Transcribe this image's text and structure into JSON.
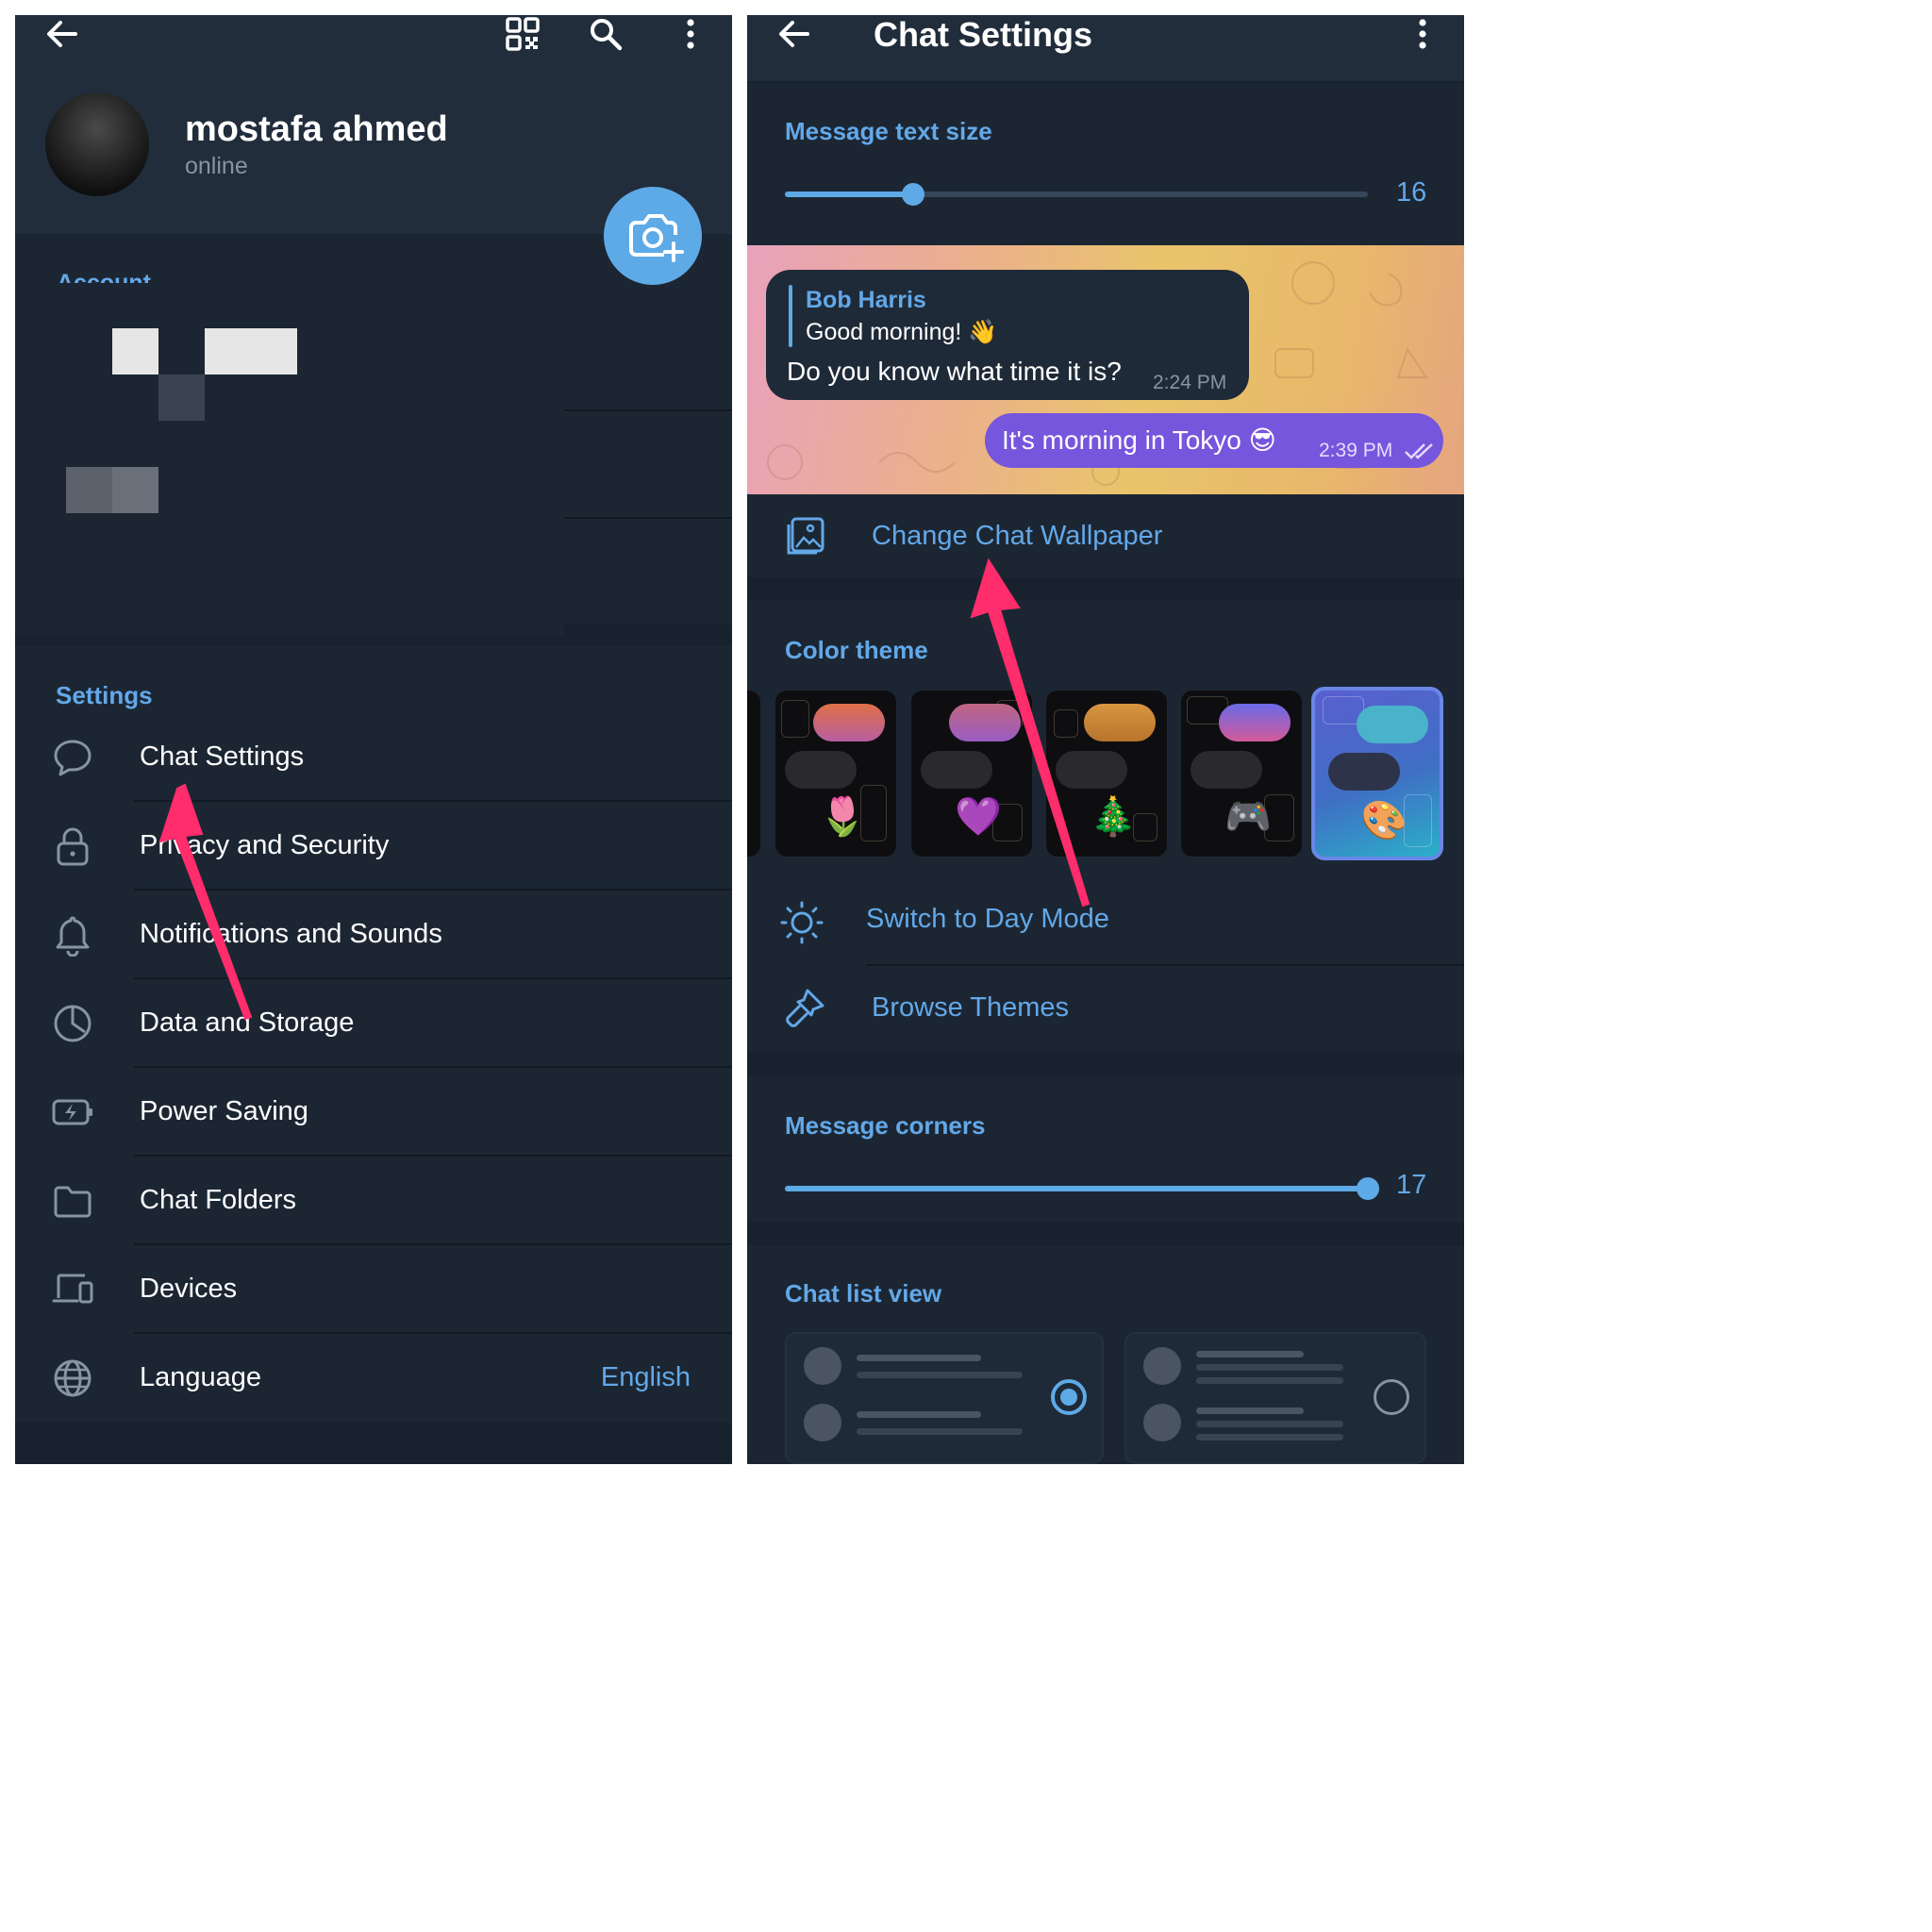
{
  "left_screen": {
    "profile": {
      "name": "mostafa ahmed",
      "status": "online"
    },
    "account_label": "Account",
    "settings_header": "Settings",
    "settings_items": [
      {
        "label": "Chat Settings",
        "icon": "chat-bubble-icon"
      },
      {
        "label": "Privacy and Security",
        "icon": "lock-icon"
      },
      {
        "label": "Notifications and Sounds",
        "icon": "bell-icon"
      },
      {
        "label": "Data and Storage",
        "icon": "pie-chart-icon"
      },
      {
        "label": "Power Saving",
        "icon": "battery-bolt-icon"
      },
      {
        "label": "Chat Folders",
        "icon": "folder-icon"
      },
      {
        "label": "Devices",
        "icon": "devices-icon"
      },
      {
        "label": "Language",
        "icon": "globe-icon",
        "value": "English"
      }
    ]
  },
  "right_screen": {
    "title": "Chat Settings",
    "text_size": {
      "label": "Message text size",
      "value": "16",
      "level": 0.22
    },
    "preview": {
      "reply_name": "Bob Harris",
      "reply_text": "Good morning! 👋",
      "incoming_text": "Do you know what time it is?",
      "incoming_time": "2:24 PM",
      "outgoing_text": "It's morning in Tokyo 😎",
      "outgoing_time": "2:39 PM"
    },
    "change_wallpaper": "Change Chat Wallpaper",
    "color_theme": {
      "label": "Color theme",
      "themes": [
        {
          "emoji": "🌷",
          "pill_color": "#d86a56"
        },
        {
          "emoji": "💜",
          "pill_color": "#b2628a"
        },
        {
          "emoji": "🎄",
          "pill_color": "#c98a3c"
        },
        {
          "emoji": "🎮",
          "pill_color": "#8f5ad6"
        },
        {
          "emoji": "🎨",
          "pill_color": "#4bb3c9",
          "selected": true
        }
      ]
    },
    "switch_day_mode": "Switch to Day Mode",
    "browse_themes": "Browse Themes",
    "corners": {
      "label": "Message corners",
      "value": "17",
      "level": 1.0
    },
    "chat_list_view": {
      "label": "Chat list view",
      "selected_option": 1
    }
  },
  "colors": {
    "background": "#18212e",
    "header": "#212d3b",
    "section": "#1c2633",
    "accent": "#63a8e8",
    "annotation_arrow": "#ff2d6c",
    "outgoing_bubble": "#7656dc"
  }
}
